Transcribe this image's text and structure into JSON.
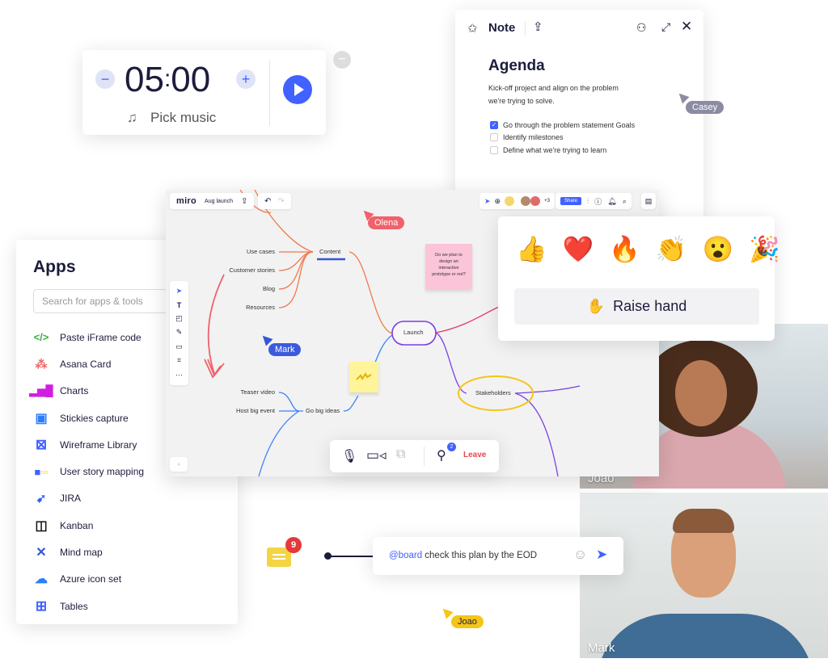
{
  "timer": {
    "minutes": "05",
    "seconds": "00",
    "separator": ":",
    "music_label": "Pick music",
    "minus": "−",
    "plus": "+"
  },
  "note": {
    "title": "Note",
    "heading": "Agenda",
    "description": "Kick-off project and align on the problem we're trying to solve.",
    "checklist": [
      {
        "label": "Go through the problem statement Goals",
        "checked": true
      },
      {
        "label": "Identify milestones",
        "checked": false
      },
      {
        "label": "Define what we're trying to learn",
        "checked": false
      }
    ]
  },
  "board": {
    "logo": "miro",
    "board_name": "Aug launch",
    "share_label": "Share",
    "extra_collaborators": "+3",
    "accent": "#4262ff",
    "mindmap": {
      "root": "Launch",
      "content": "Content",
      "content_children": [
        "Use cases",
        "Customer stories",
        "Blog",
        "Resources"
      ],
      "big_ideas": "Go big ideas",
      "big_ideas_children": [
        "Teaser video",
        "Host big event"
      ],
      "stakeholders": "Stakeholders"
    },
    "sticky_note": "Do we plan to design an interactive prototype or not?"
  },
  "cursors": {
    "olena": "Olena",
    "mark": "Mark",
    "casey": "Casey",
    "joao": "Joao"
  },
  "apps": {
    "title": "Apps",
    "search_placeholder": "Search for apps & tools",
    "items": [
      {
        "label": "Paste iFrame code",
        "icon": "code-icon"
      },
      {
        "label": "Asana Card",
        "icon": "asana-icon"
      },
      {
        "label": "Charts",
        "icon": "bar-chart-icon"
      },
      {
        "label": "Stickies capture",
        "icon": "capture-icon"
      },
      {
        "label": "Wireframe Library",
        "icon": "wireframe-icon"
      },
      {
        "label": "User story mapping",
        "icon": "story-map-icon"
      },
      {
        "label": "JIRA",
        "icon": "jira-icon"
      },
      {
        "label": "Kanban",
        "icon": "kanban-icon"
      },
      {
        "label": "Mind map",
        "icon": "mind-map-icon"
      },
      {
        "label": "Azure icon set",
        "icon": "azure-icon"
      },
      {
        "label": "Tables",
        "icon": "table-icon"
      }
    ]
  },
  "reactions": {
    "emojis": [
      "👍",
      "❤️",
      "🔥",
      "👏",
      "😮",
      "🎉"
    ],
    "raise_hand_label": "Raise hand",
    "raise_hand_icon": "✋"
  },
  "call": {
    "participants_count": "2",
    "leave_label": "Leave",
    "leave_color": "#e5484d"
  },
  "chat": {
    "mention": "@board",
    "message": " check this plan by the EOD",
    "notification_count": "9"
  },
  "videos": [
    {
      "name": "Joao"
    },
    {
      "name": "Mark"
    }
  ]
}
